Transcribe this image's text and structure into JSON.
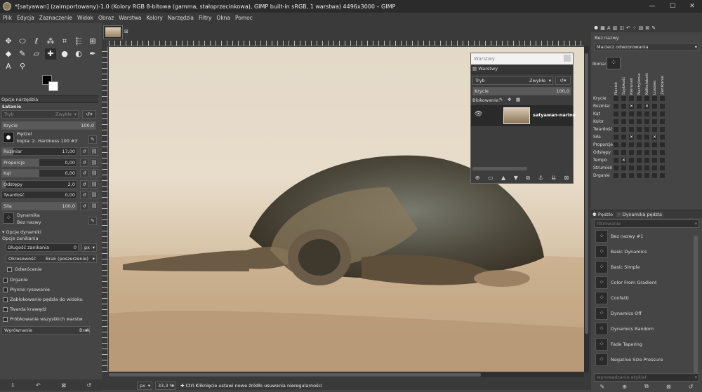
{
  "window": {
    "title": "*[satyawan] (zaimportowany)-1.0 (Kolory RGB 8-bitowa (gamma, stałoprzecinkowa), GIMP built-in sRGB, 1 warstwa) 4496x3000 – GIMP",
    "min": "—",
    "max": "☐",
    "close": "✕"
  },
  "menu": [
    "Plik",
    "Edycja",
    "Zaznaczenie",
    "Widok",
    "Obraz",
    "Warstwa",
    "Kolory",
    "Narzędzia",
    "Filtry",
    "Okna",
    "Pomoc"
  ],
  "tool_options": {
    "tab_label": "Opcje narzędzia",
    "tool_name": "Łatanie",
    "mode_label": "Tryb",
    "mode_value": "Zwykłe",
    "opacity_label": "Krycie",
    "opacity_value": "100,0",
    "brush_label": "Pędzel",
    "brush_value": "kopia: 2. Hardness 100 #3",
    "sliders": [
      {
        "label": "Rozmiar",
        "value": "17,00",
        "fill": 0.15
      },
      {
        "label": "Proporcje",
        "value": "0,00",
        "fill": 0.5
      },
      {
        "label": "Kąt",
        "value": "0,00",
        "fill": 0.5
      },
      {
        "label": "Odstępy",
        "value": "2,0",
        "fill": 0.05
      },
      {
        "label": "Twardość",
        "value": "0,00",
        "fill": 0
      },
      {
        "label": "Siła",
        "value": "100,0",
        "fill": 1
      }
    ],
    "dynamics_label": "Dynamika",
    "dynamics_value": "Bez nazwy",
    "dynamics_options": "Opcje dynamiki",
    "fade_options": "Opcje zanikania",
    "fade_length_label": "Długość zanikania",
    "fade_length_value": "0",
    "fade_unit": "px",
    "repeat_label": "Okresowość",
    "repeat_value": "Brak (poszerzenie)",
    "reverse_label": "Odwrócenie",
    "checkboxes": [
      "Drganie",
      "Płynne rysowanie",
      "Zablokowanie pędzla do widoku",
      "Twarda krawędź",
      "Próbkowanie wszystkich warstw"
    ],
    "alignment_label": "Wyrównanie",
    "alignment_value": "Brak"
  },
  "canvas": {
    "image_tab_label": "satyawan",
    "zoom_unit": "px",
    "zoom_value": "33,3 %",
    "status_text": "Ctrl-Kliknięcie ustawi nowe źródło usuwania nieregularności"
  },
  "layers": {
    "window_title": "Warstwy",
    "tab_label": "Warstwy",
    "mode_label": "Tryb",
    "mode_value": "Zwykłe",
    "opacity_label": "Krycie",
    "opacity_value": "100,0",
    "lock_label": "Blokowanie:",
    "layer_name": "satyawan-narine"
  },
  "dynamics_editor": {
    "name": "Bez nazwy",
    "matrix_label": "Macierz odwzorowania",
    "icon_label": "Ikona:",
    "columns": [
      "Nacisk",
      "Szybkość",
      "Kierunek",
      "Nachylenie",
      "Kółko/obrót",
      "Losowo",
      "Zanikanie"
    ],
    "rows": [
      "Krycie",
      "Rozmiar",
      "Kąt",
      "Kolor",
      "Twardość",
      "Siła",
      "Proporcje",
      "Odstępy",
      "Tempo",
      "Strumień",
      "Drganie"
    ],
    "checked": [
      [
        1,
        2
      ],
      [
        1,
        4
      ],
      [
        5,
        2
      ],
      [
        5,
        5
      ],
      [
        8,
        1
      ]
    ]
  },
  "brush_dynamics": {
    "tab1": "Pędzle",
    "tab2": "Dynamika pędzla",
    "filter_placeholder": "filtrowanie",
    "items": [
      "Bez nazwy #1",
      "Basic Dynamics",
      "Basic Simple",
      "Color From Gradient",
      "Confetti",
      "Dynamics Off",
      "Dynamics Random",
      "Fade Tapering",
      "Negative Size Pressure"
    ],
    "tag_placeholder": "wprowadzanie etykiet"
  }
}
